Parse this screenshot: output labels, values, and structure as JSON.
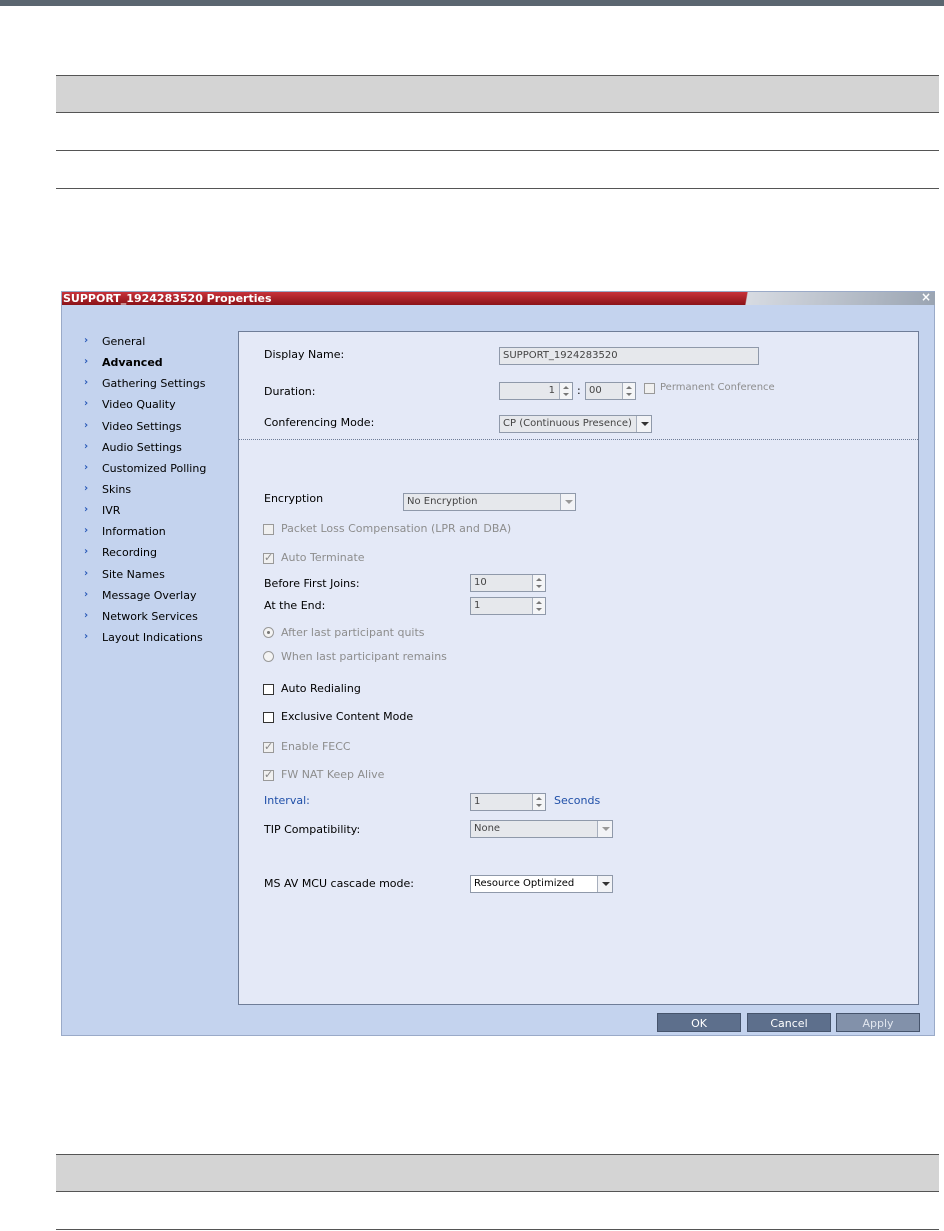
{
  "dialog": {
    "title": "SUPPORT_1924283520 Properties",
    "close_label": "×"
  },
  "nav": {
    "items": [
      {
        "label": "General"
      },
      {
        "label": "Advanced",
        "active": true
      },
      {
        "label": "Gathering Settings"
      },
      {
        "label": "Video Quality"
      },
      {
        "label": "Video Settings"
      },
      {
        "label": "Audio Settings"
      },
      {
        "label": "Customized Polling"
      },
      {
        "label": "Skins"
      },
      {
        "label": "IVR"
      },
      {
        "label": "Information"
      },
      {
        "label": "Recording"
      },
      {
        "label": "Site Names"
      },
      {
        "label": "Message Overlay"
      },
      {
        "label": "Network Services"
      },
      {
        "label": "Layout Indications"
      }
    ],
    "chevron": "›"
  },
  "header_fields": {
    "display_name_label": "Display Name:",
    "display_name_value": "SUPPORT_1924283520",
    "duration_label": "Duration:",
    "duration_hours": "1",
    "duration_sep": ":",
    "duration_minutes": "00",
    "permanent_label": "Permanent Conference",
    "mode_label": "Conferencing Mode:",
    "mode_value": "CP (Continuous Presence)"
  },
  "advanced": {
    "encryption_label": "Encryption",
    "encryption_value": "No Encryption",
    "packet_loss_label": "Packet Loss Compensation (LPR and DBA)",
    "auto_terminate_label": "Auto Terminate",
    "before_first_label": "Before First Joins:",
    "before_first_value": "10",
    "at_end_label": "At the End:",
    "at_end_value": "1",
    "after_last_label": "After last participant quits",
    "when_last_label": "When last participant remains",
    "auto_redial_label": "Auto Redialing",
    "exclusive_label": "Exclusive Content Mode",
    "fecc_label": "Enable FECC",
    "fw_nat_label": "FW NAT Keep Alive",
    "interval_label": "Interval:",
    "interval_value": "1",
    "seconds_label": "Seconds",
    "tip_label": "TIP Compatibility:",
    "tip_value": "None",
    "ms_label": "MS AV MCU cascade mode:",
    "ms_value": "Resource Optimized",
    "tick": "✓"
  },
  "buttons": {
    "ok": "OK",
    "cancel": "Cancel",
    "apply": "Apply"
  },
  "colors": {
    "title_red": "#b01e26",
    "dialog_bg": "#c4d3ee",
    "panel_bg": "#e4e9f7",
    "button_bg": "#5d6f8c",
    "accent_blue": "#1f4fa8"
  }
}
